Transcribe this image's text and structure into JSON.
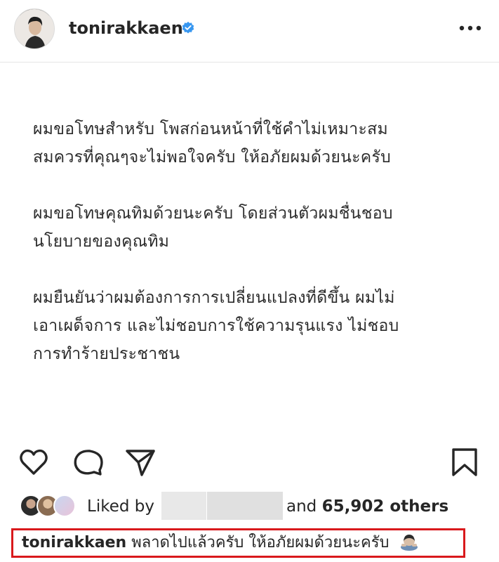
{
  "header": {
    "username": "tonirakkaen",
    "verified": true,
    "more_icon": "more-horizontal-icon",
    "avatar_icon": "profile-avatar"
  },
  "post": {
    "paragraphs": [
      [
        "ผมขอโทษสำหรับ โพสก่อนหน้าที่ใช้คำไม่เหมาะสม",
        "สมควรที่คุณๆจะไม่พอใจครับ  ให้อภัยผมด้วยนะครับ"
      ],
      [
        "ผมขอโทษคุณทิมด้วยนะครับ  โดยส่วนตัวผมชื่นชอบ",
        "นโยบายของคุณทิม"
      ],
      [
        "ผมยืนยันว่าผมต้องการการเปลี่ยนแปลงที่ดีขึ้น ผมไม่",
        "เอาเผด็จการ และไม่ชอบการใช้ความรุนแรง ไม่ชอบ",
        "การทำร้ายประชาชน"
      ]
    ]
  },
  "actions": {
    "like_icon": "heart-icon",
    "comment_icon": "comment-icon",
    "share_icon": "send-icon",
    "save_icon": "bookmark-icon"
  },
  "likes": {
    "liked_by_label": "Liked by",
    "and_label": "and",
    "count_text": "65,902 others"
  },
  "caption": {
    "username": "tonirakkaen",
    "text": "พลาดไปแล้วครับ  ให้อภัยผมด้วยนะครับ",
    "emoji_icon": "person-bowing-emoji"
  },
  "colors": {
    "verified_blue": "#3897f0",
    "highlight_red": "#d9191c",
    "text": "#262626"
  }
}
